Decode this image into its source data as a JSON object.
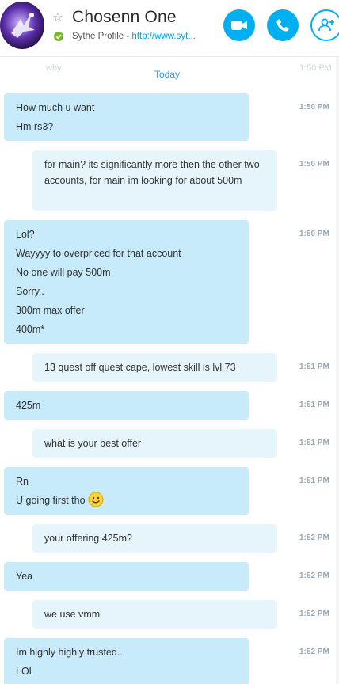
{
  "header": {
    "contact_name": "Chosenn One",
    "profile_label": "Sythe Profile - ",
    "profile_link": "http://www.syt...",
    "favorite_icon": "star-outline-icon",
    "status_icon": "online-check-icon",
    "video_call_icon": "video-camera-icon",
    "audio_call_icon": "phone-icon",
    "add_people_icon": "add-person-icon"
  },
  "chat": {
    "faded_left": "why",
    "faded_right": "1:50 PM",
    "date_divider": "Today",
    "messages": [
      {
        "from": "them",
        "lines": [
          "How much u want",
          "Hm rs3?"
        ],
        "time": "1:50 PM"
      },
      {
        "from": "me",
        "lines": [
          "for main? its significantly more then the other two accounts, for main im looking for about 500m"
        ],
        "time": "1:50 PM"
      },
      {
        "from": "them",
        "lines": [
          "Lol?",
          "Wayyyy to overpriced for that account",
          "No one will pay 500m",
          "Sorry..",
          "300m max offer",
          "400m*"
        ],
        "time": "1:50 PM"
      },
      {
        "from": "me",
        "lines": [
          "13 quest off quest cape, lowest skill is lvl 73"
        ],
        "time": "1:51 PM"
      },
      {
        "from": "them",
        "lines": [
          "425m"
        ],
        "time": "1:51 PM"
      },
      {
        "from": "me",
        "lines": [
          "what is your best offer"
        ],
        "time": "1:51 PM"
      },
      {
        "from": "them",
        "lines": [
          "Rn",
          "U going first tho"
        ],
        "time": "1:51 PM"
      },
      {
        "from": "me",
        "lines": [
          "your offering 425m?"
        ],
        "time": "1:52 PM"
      },
      {
        "from": "them",
        "lines": [
          "Yea"
        ],
        "time": "1:52 PM"
      },
      {
        "from": "me",
        "lines": [
          "we use vmm"
        ],
        "time": "1:52 PM"
      },
      {
        "from": "them",
        "lines": [
          "Im highly highly trusted..",
          "LOL"
        ],
        "time": "1:52 PM"
      }
    ]
  },
  "colors": {
    "accent": "#00aff0",
    "incoming_bubble": "#c7ebfb",
    "outgoing_bubble": "#e6f5fc",
    "online": "#7ab829"
  }
}
